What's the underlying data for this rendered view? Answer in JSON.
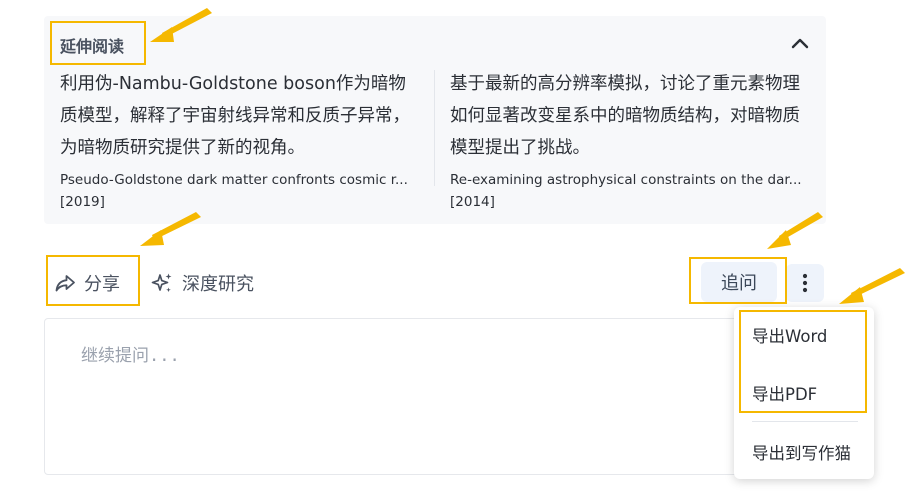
{
  "reading": {
    "title": "延伸阅读",
    "cards": [
      {
        "summary": "利用伪-Nambu-Goldstone boson作为暗物质模型，解释了宇宙射线异常和反质子异常，为暗物质研究提供了新的视角。",
        "ref_title": "Pseudo-Goldstone dark matter confronts cosmic r...",
        "year": "[2019]"
      },
      {
        "summary": "基于最新的高分辨率模拟，讨论了重元素物理如何显著改变星系中的暗物质结构，对暗物质模型提出了挑战。",
        "ref_title": "Re-examining astrophysical constraints on the dar...",
        "year": "[2014]"
      }
    ]
  },
  "actions": {
    "share_label": "分享",
    "deep_research_label": "深度研究",
    "followup_label": "追问"
  },
  "input": {
    "placeholder": "继续提问..."
  },
  "menu": {
    "items": [
      "导出Word",
      "导出PDF",
      "导出到写作猫"
    ]
  },
  "colors": {
    "highlight": "#f5b800",
    "panel_bg": "#f7f8fa",
    "button_bg": "#eef3fb"
  },
  "icons": {
    "collapse": "chevron-up-icon",
    "share": "share-icon",
    "deep_research": "sparkle-icon",
    "more": "more-vertical-icon"
  }
}
